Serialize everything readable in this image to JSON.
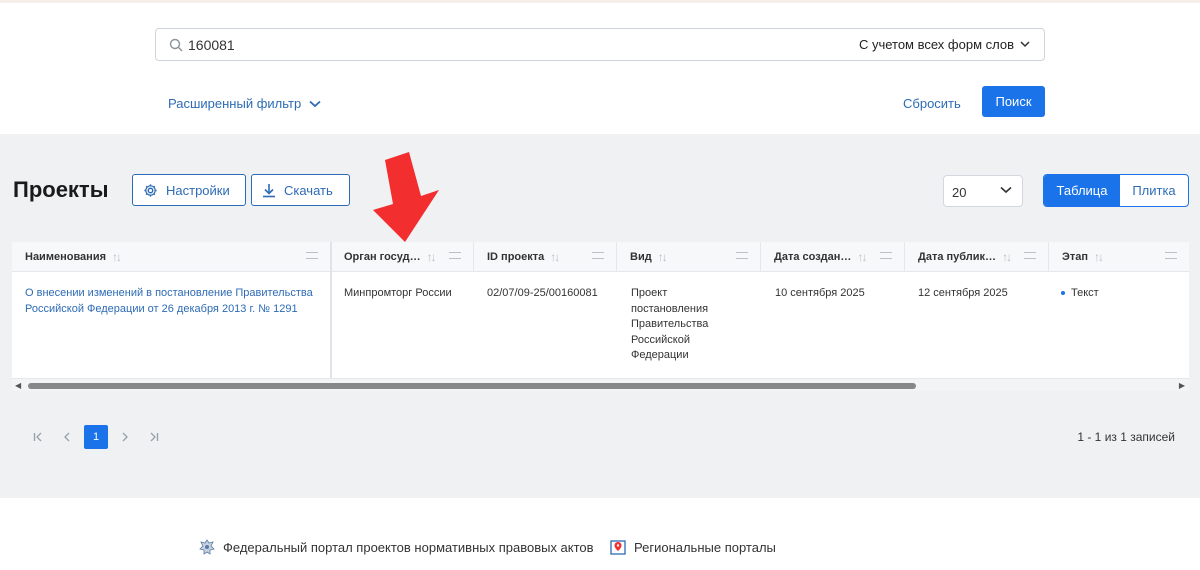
{
  "search": {
    "value": "160081",
    "morph_label": "С учетом всех форм слов",
    "advanced_filter": "Расширенный фильтр",
    "reset": "Сбросить",
    "submit": "Поиск"
  },
  "projects": {
    "title": "Проекты",
    "settings_label": "Настройки",
    "download_label": "Скачать",
    "per_page": "20",
    "view_table": "Таблица",
    "view_tile": "Плитка"
  },
  "table": {
    "columns": [
      "Наименования",
      "Орган госуд…",
      "ID проекта",
      "Вид",
      "Дата создан…",
      "Дата публик…",
      "Этап"
    ],
    "rows": [
      {
        "name_line1": "О внесении изменений в постановление Правительства",
        "name_line2": "Российской Федерации от 26 декабря 2013 г. № 1291",
        "organ": "Минпромторг России",
        "id": "02/07/09-25/00160081",
        "kind_lines": [
          "Проект",
          "постановления",
          "Правительства",
          "Российской",
          "Федерации"
        ],
        "created": "10 сентября 2025",
        "published": "12 сентября 2025",
        "stage": "Текст"
      }
    ]
  },
  "pagination": {
    "current_page": "1",
    "records": "1 - 1 из 1 записей"
  },
  "footer": {
    "federal": "Федеральный портал проектов нормативных правовых актов",
    "regional": "Региональные порталы"
  },
  "colors": {
    "accent": "#1a73e8",
    "link": "#2d6bb5",
    "annotation_arrow": "#f32e2e",
    "panel_bg": "#f0f1f3"
  },
  "icons": {
    "search": "search-icon",
    "chevron": "chevron-down-icon",
    "settings": "gear-icon",
    "download": "download-icon",
    "first": "first-page-icon",
    "prev": "prev-page-icon",
    "next": "next-page-icon",
    "last": "last-page-icon",
    "emblem": "emblem-icon",
    "map": "map-icon"
  }
}
